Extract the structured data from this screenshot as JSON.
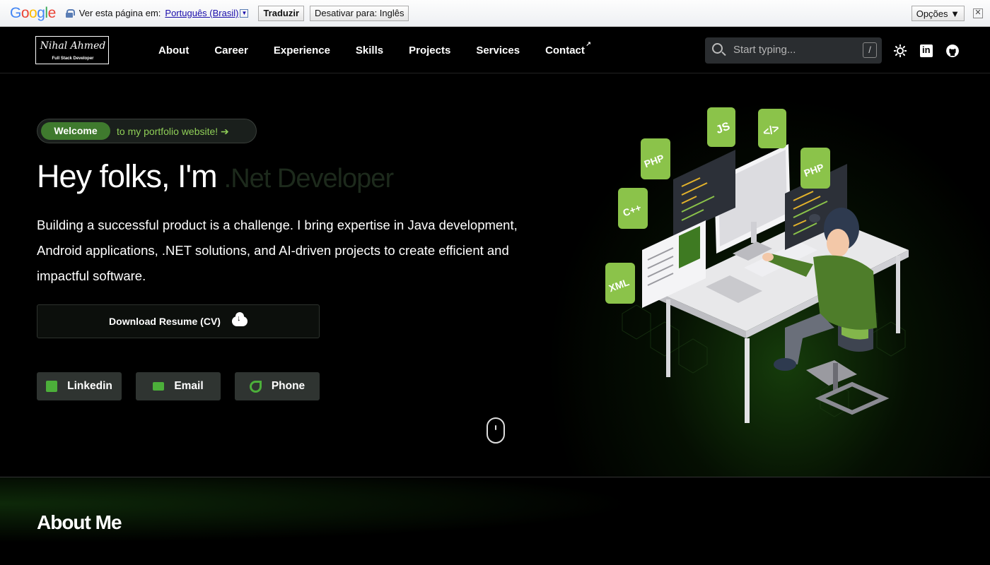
{
  "translate_bar": {
    "logo_letters": [
      "G",
      "o",
      "o",
      "g",
      "l",
      "e"
    ],
    "prompt": "Ver esta página em:",
    "language": "Português (Brasil)",
    "dropdown_glyph": "▼",
    "translate_button": "Traduzir",
    "disable_button": "Desativar para: Inglês",
    "options_button": "Opções ▼",
    "close_glyph": "✕"
  },
  "nav": {
    "logo_name": "Nihal Ahmed",
    "logo_subtitle": "Full Stack Developer",
    "links": [
      "About",
      "Career",
      "Experience",
      "Skills",
      "Projects",
      "Services",
      "Contact"
    ],
    "contact_external_glyph": "↗",
    "search_placeholder": "Start typing...",
    "search_shortcut": "/"
  },
  "hero": {
    "welcome_pill": "Welcome",
    "welcome_text": "to my portfolio website! ➔",
    "title": "Hey folks, I'm",
    "role": ".Net Developer",
    "description": "Building a successful product is a challenge. I bring expertise in Java development, Android applications, .NET solutions, and AI-driven projects to create efficient and impactful software.",
    "resume_button": "Download Resume (CV)",
    "social_buttons": [
      "Linkedin",
      "Email",
      "Phone"
    ],
    "illustration_tags": [
      "JS",
      "</>",
      "PHP",
      "PHP",
      "C++",
      "XML"
    ]
  },
  "about": {
    "title": "About Me"
  },
  "colors": {
    "accent": "#8bc34a",
    "pill_green": "#3f7a2e",
    "background": "#000000"
  }
}
